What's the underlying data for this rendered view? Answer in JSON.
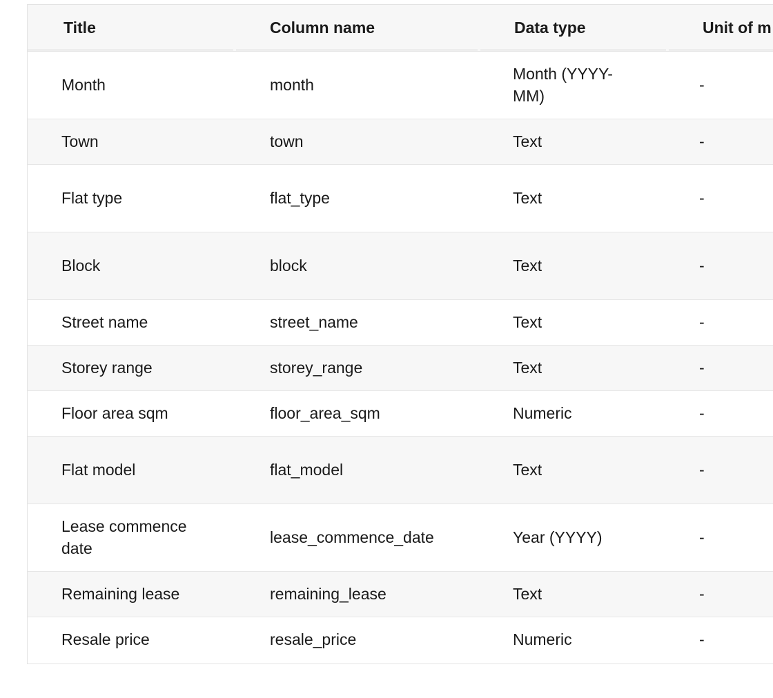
{
  "table": {
    "headers": [
      "Title",
      "Column name",
      "Data type",
      "Unit of m"
    ],
    "rows": [
      {
        "title": "Month",
        "column": "month",
        "type": "Month (YYYY-MM)",
        "unit": "-"
      },
      {
        "title": "Town",
        "column": "town",
        "type": "Text",
        "unit": "-"
      },
      {
        "title": "Flat type",
        "column": "flat_type",
        "type": "Text",
        "unit": "-"
      },
      {
        "title": "Block",
        "column": "block",
        "type": "Text",
        "unit": "-"
      },
      {
        "title": "Street name",
        "column": "street_name",
        "type": "Text",
        "unit": "-"
      },
      {
        "title": "Storey range",
        "column": "storey_range",
        "type": "Text",
        "unit": "-"
      },
      {
        "title": "Floor area sqm",
        "column": "floor_area_sqm",
        "type": "Numeric",
        "unit": "-"
      },
      {
        "title": "Flat model",
        "column": "flat_model",
        "type": "Text",
        "unit": "-"
      },
      {
        "title": "Lease commence date",
        "column": "lease_commence_date",
        "type": "Year (YYYY)",
        "unit": "-"
      },
      {
        "title": "Remaining lease",
        "column": "remaining_lease",
        "type": "Text",
        "unit": "-"
      },
      {
        "title": "Resale price",
        "column": "resale_price",
        "type": "Numeric",
        "unit": "-"
      }
    ]
  }
}
